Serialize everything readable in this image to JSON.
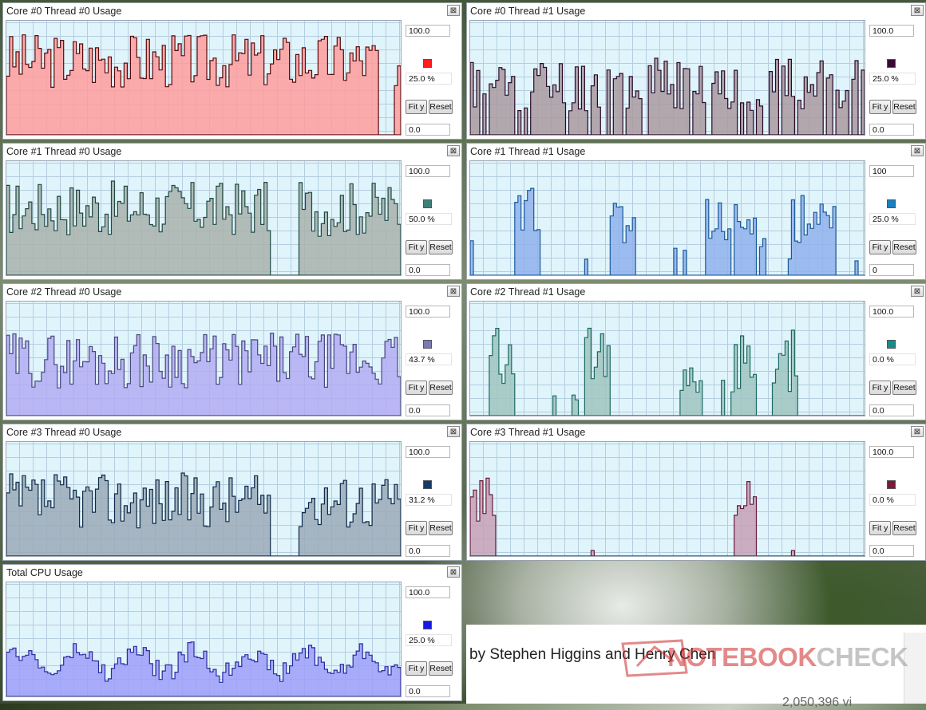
{
  "panels": [
    {
      "title": "Core #0 Thread #0 Usage",
      "max": "100.0",
      "min": "0.0",
      "pct": "25.0 %",
      "color": "#ff2020",
      "fill": "#ff9c9c",
      "line": "#5a0a0a",
      "seed": 3,
      "level": 62,
      "zero_tail": true
    },
    {
      "title": "Core #0 Thread #1 Usage",
      "max": "100.0",
      "min": "0.0",
      "pct": "25.0 %",
      "color": "#3a0a36",
      "fill": "#a8999f",
      "line": "#2a0a28",
      "seed": 11,
      "level": 40,
      "gaps": true
    },
    {
      "title": "Core #1 Thread #0 Usage",
      "max": "100.0",
      "min": "0.0",
      "pct": "50.0 %",
      "color": "#3f7f7a",
      "fill": "#a8b2ac",
      "line": "#1e4a44",
      "seed": 17,
      "level": 55,
      "dip": true
    },
    {
      "title": "Core #1 Thread #1 Usage",
      "max": "100",
      "min": "0",
      "pct": "25.0 %",
      "color": "#1a7fbf",
      "fill": "#8fb0ec",
      "line": "#1a5a9a",
      "seed": 23,
      "level": 12,
      "bursts": true
    },
    {
      "title": "Core #2 Thread #0 Usage",
      "max": "100.0",
      "min": "0.0",
      "pct": "43.7 %",
      "color": "#7b78b2",
      "fill": "#b2acf2",
      "line": "#4a4780",
      "seed": 29,
      "level": 45
    },
    {
      "title": "Core #2 Thread #1 Usage",
      "max": "100.0",
      "min": "0.0",
      "pct": "0.0 %",
      "color": "#1a8a8a",
      "fill": "#9fc4c0",
      "line": "#1a6a60",
      "seed": 31,
      "level": 4,
      "bursts": true
    },
    {
      "title": "Core #3 Thread #0 Usage",
      "max": "100.0",
      "min": "0.0",
      "pct": "31.2 %",
      "color": "#123a6a",
      "fill": "#9aa9b6",
      "line": "#0f2a4a",
      "seed": 37,
      "level": 45,
      "dip": true
    },
    {
      "title": "Core #3 Thread #1 Usage",
      "max": "100.0",
      "min": "0.0",
      "pct": "0.0 %",
      "color": "#7a1a3a",
      "fill": "#c7a0b6",
      "line": "#6a1a3a",
      "seed": 41,
      "level": 2,
      "bursts": true
    },
    {
      "title": "Total CPU Usage",
      "max": "100.0",
      "min": "0.0",
      "pct": "25.0 %",
      "color": "#1818e0",
      "fill": "#9e9ef8",
      "line": "#2a2aa0",
      "seed": 47,
      "level": 28,
      "smooth": true
    }
  ],
  "fit_label": "Fit y",
  "reset_label": "Reset",
  "close_label": "⊠",
  "article": {
    "byline": "by Stephen Higgins and Henry Chen",
    "views": "2,050,396 vi"
  },
  "watermark": {
    "brand_red": "NOTEBOOK",
    "brand_gray": "CHECK"
  }
}
